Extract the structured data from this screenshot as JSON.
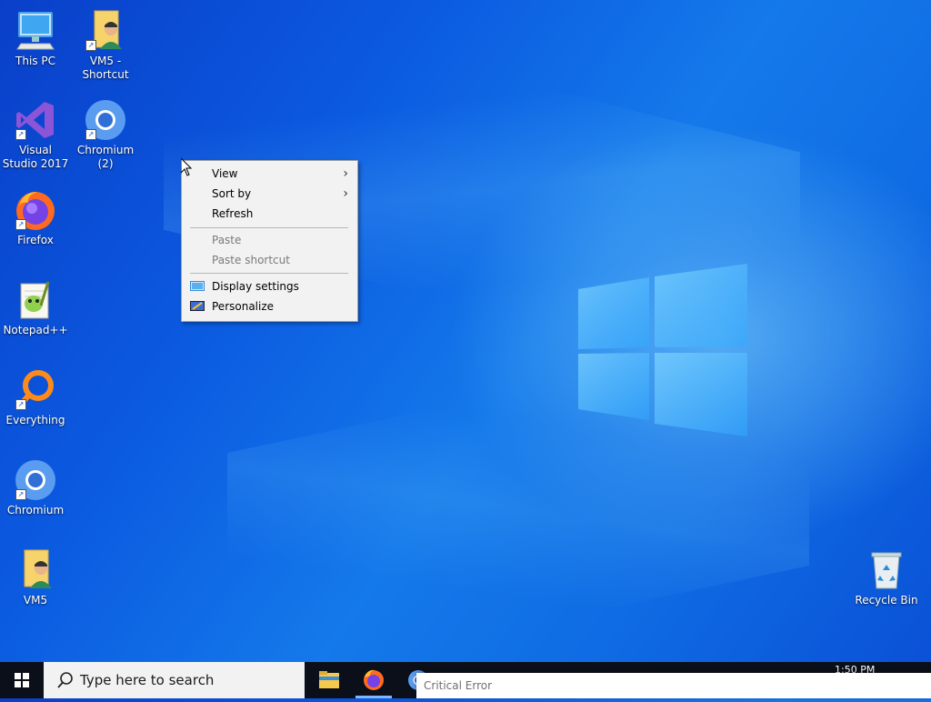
{
  "desktop": {
    "icons": [
      {
        "label": "This PC",
        "icon": "this-pc-icon"
      },
      {
        "label": "VM5 - Shortcut",
        "icon": "user-folder-icon"
      },
      {
        "label": "Visual Studio 2017",
        "icon": "visual-studio-icon"
      },
      {
        "label": "Chromium (2)",
        "icon": "chromium-icon"
      },
      {
        "label": "Firefox",
        "icon": "firefox-icon"
      },
      {
        "label": "Notepad++",
        "icon": "notepadpp-icon"
      },
      {
        "label": "Everything",
        "icon": "everything-icon"
      },
      {
        "label": "Chromium",
        "icon": "chromium-icon"
      },
      {
        "label": "VM5",
        "icon": "user-folder-icon"
      },
      {
        "label": "Recycle Bin",
        "icon": "recycle-bin-icon"
      }
    ]
  },
  "context_menu": {
    "items": [
      {
        "label": "View",
        "submenu": true,
        "enabled": true
      },
      {
        "label": "Sort by",
        "submenu": true,
        "enabled": true
      },
      {
        "label": "Refresh",
        "submenu": false,
        "enabled": true
      },
      {
        "label": "Paste",
        "submenu": false,
        "enabled": false
      },
      {
        "label": "Paste shortcut",
        "submenu": false,
        "enabled": false
      },
      {
        "label": "Display settings",
        "submenu": false,
        "enabled": true,
        "icon": "display-settings-icon"
      },
      {
        "label": "Personalize",
        "submenu": false,
        "enabled": true,
        "icon": "personalize-icon"
      }
    ]
  },
  "taskbar": {
    "search_placeholder": "Type here to search",
    "clock": "1:50 PM",
    "pinned": [
      "file-explorer-icon",
      "firefox-icon",
      "chromium-icon"
    ],
    "notification": "Critical Error"
  },
  "colors": {
    "accent": "#0b5ae0",
    "taskbar": "#0a0f1a"
  }
}
